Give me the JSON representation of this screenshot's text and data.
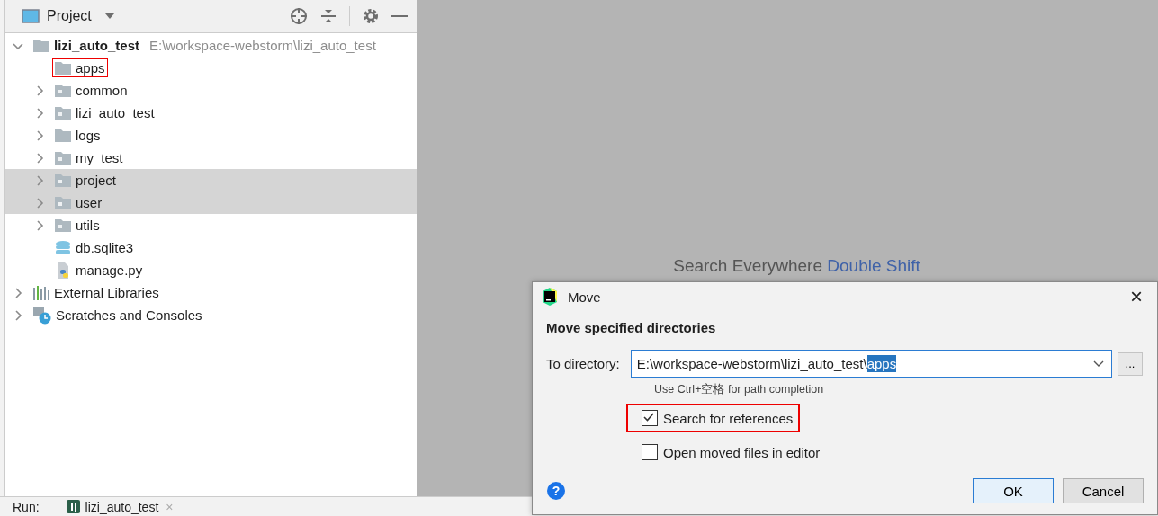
{
  "project_panel": {
    "title": "Project",
    "tree": [
      {
        "label": "lizi_auto_test",
        "path": "E:\\workspace-webstorm\\lizi_auto_test",
        "kind": "root",
        "expandable": true,
        "expanded": true,
        "selected": false,
        "outlined": false,
        "children": [
          {
            "label": "apps",
            "kind": "folder",
            "expandable": false,
            "selected": false,
            "outlined": true
          },
          {
            "label": "common",
            "kind": "package",
            "expandable": true,
            "expanded": false,
            "selected": false,
            "outlined": false
          },
          {
            "label": "lizi_auto_test",
            "kind": "package",
            "expandable": true,
            "expanded": false,
            "selected": false,
            "outlined": false
          },
          {
            "label": "logs",
            "kind": "folder",
            "expandable": true,
            "expanded": false,
            "selected": false,
            "outlined": false
          },
          {
            "label": "my_test",
            "kind": "package",
            "expandable": true,
            "expanded": false,
            "selected": false,
            "outlined": false
          },
          {
            "label": "project",
            "kind": "package",
            "expandable": true,
            "expanded": false,
            "selected": true,
            "outlined": false
          },
          {
            "label": "user",
            "kind": "package",
            "expandable": true,
            "expanded": false,
            "selected": true,
            "outlined": false
          },
          {
            "label": "utils",
            "kind": "package",
            "expandable": true,
            "expanded": false,
            "selected": false,
            "outlined": false
          },
          {
            "label": "db.sqlite3",
            "kind": "database",
            "expandable": false,
            "selected": false,
            "outlined": false
          },
          {
            "label": "manage.py",
            "kind": "python",
            "expandable": false,
            "selected": false,
            "outlined": false
          }
        ]
      },
      {
        "label": "External Libraries",
        "kind": "libraries",
        "expandable": true,
        "expanded": false,
        "selected": false,
        "outlined": false
      },
      {
        "label": "Scratches and Consoles",
        "kind": "scratches",
        "expandable": true,
        "expanded": false,
        "selected": false,
        "outlined": false
      }
    ]
  },
  "editor_hint": {
    "text": "Search Everywhere",
    "shortcut": "Double Shift"
  },
  "run_bar": {
    "label": "Run:",
    "tab": "lizi_auto_test",
    "close": "×"
  },
  "dialog": {
    "title": "Move",
    "close": "×",
    "heading": "Move specified directories",
    "field_label": "To directory:",
    "field_value": "E:\\workspace-webstorm\\lizi_auto_test\\",
    "field_selection": "apps",
    "browse": "...",
    "hint": "Use Ctrl+空格 for path completion",
    "options": [
      {
        "label": "Search for references",
        "checked": true,
        "outlined": true
      },
      {
        "label": "Open moved files in editor",
        "checked": false,
        "outlined": false
      }
    ],
    "help": "?",
    "buttons": [
      {
        "label": "OK",
        "default": true
      },
      {
        "label": "Cancel",
        "default": false
      }
    ]
  }
}
